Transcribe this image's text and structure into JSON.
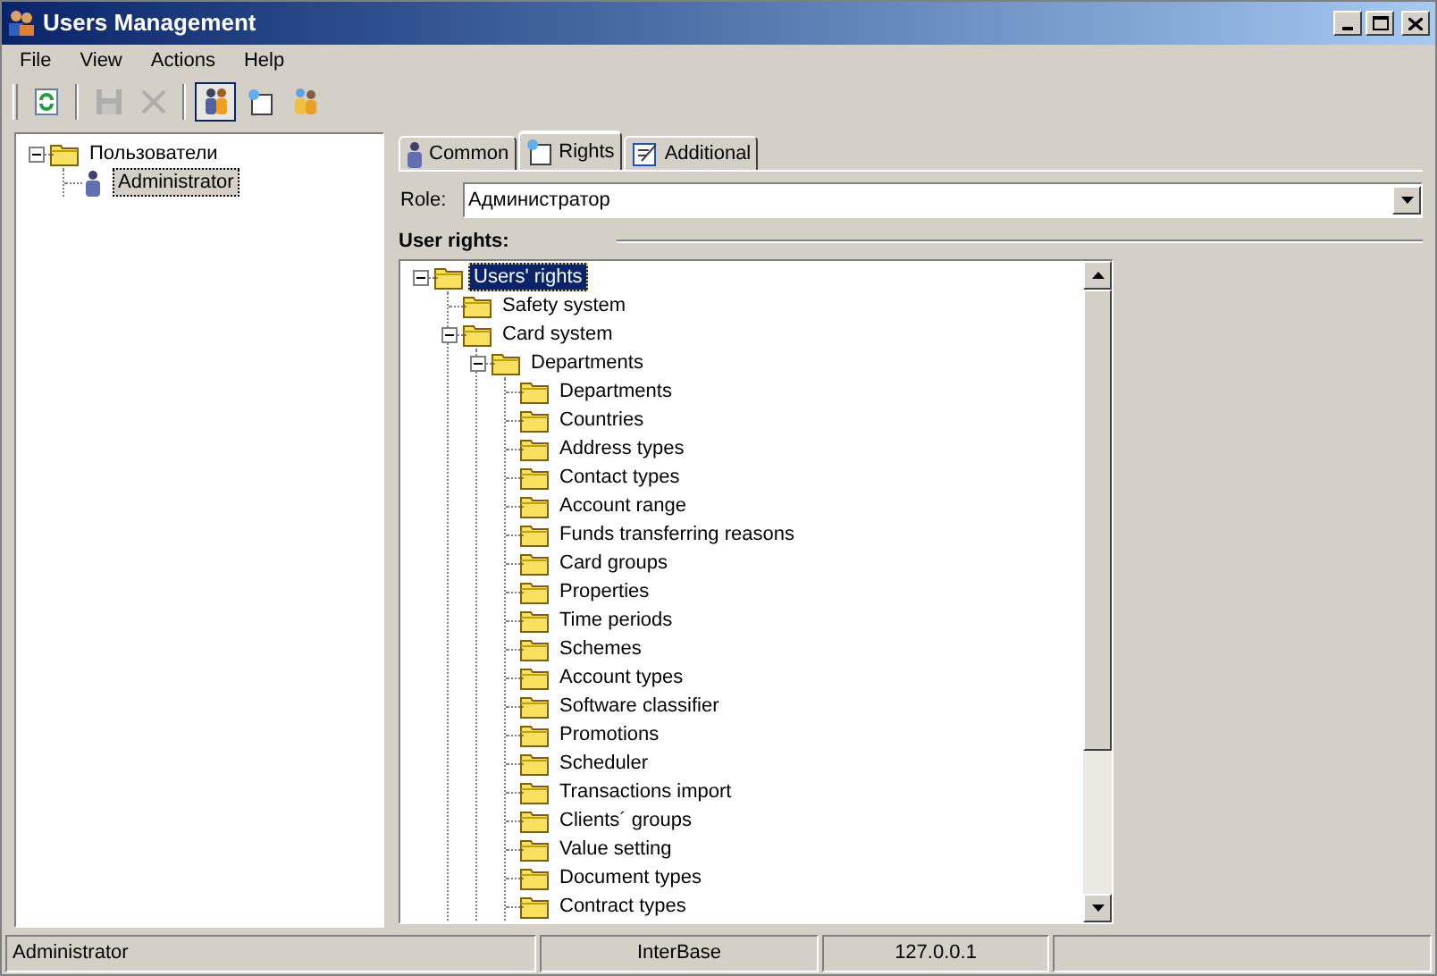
{
  "window": {
    "title": "Users Management"
  },
  "menu": [
    "File",
    "View",
    "Actions",
    "Help"
  ],
  "toolbar": [
    {
      "kind": "refresh",
      "disabled": false,
      "pressed": false
    },
    {
      "kind": "separator"
    },
    {
      "kind": "save",
      "disabled": true,
      "pressed": false
    },
    {
      "kind": "delete",
      "disabled": true,
      "pressed": false
    },
    {
      "kind": "separator"
    },
    {
      "kind": "users",
      "disabled": false,
      "pressed": true
    },
    {
      "kind": "new-role",
      "disabled": false,
      "pressed": false
    },
    {
      "kind": "user-group",
      "disabled": false,
      "pressed": false
    }
  ],
  "users_tree": [
    {
      "label": "Пользователи",
      "selected": false,
      "expanded": true,
      "children": [
        {
          "label": "Administrator",
          "selected": true
        }
      ]
    }
  ],
  "tabs": [
    {
      "label": "Common",
      "selected": false
    },
    {
      "label": "Rights",
      "selected": true
    },
    {
      "label": "Additional",
      "selected": false
    }
  ],
  "role": {
    "label": "Role:",
    "value": "Администратор"
  },
  "rights_heading": "User rights:",
  "rights_tree": [
    {
      "label": "Users' rights",
      "selected": true,
      "expanded": true,
      "children": [
        {
          "label": "Safety system",
          "selected": false
        },
        {
          "label": "Card system",
          "selected": false,
          "expanded": true,
          "children": [
            {
              "label": "Departments",
              "selected": false,
              "expanded": true,
              "children": [
                {
                  "label": "Departments",
                  "selected": false
                },
                {
                  "label": "Countries",
                  "selected": false
                },
                {
                  "label": "Address types",
                  "selected": false
                },
                {
                  "label": "Contact types",
                  "selected": false
                },
                {
                  "label": "Account range",
                  "selected": false
                },
                {
                  "label": "Funds transferring reasons",
                  "selected": false
                },
                {
                  "label": "Card groups",
                  "selected": false
                },
                {
                  "label": "Properties",
                  "selected": false
                },
                {
                  "label": "Time periods",
                  "selected": false
                },
                {
                  "label": "Schemes",
                  "selected": false
                },
                {
                  "label": "Account types",
                  "selected": false
                },
                {
                  "label": "Software classifier",
                  "selected": false
                },
                {
                  "label": "Promotions",
                  "selected": false
                },
                {
                  "label": "Scheduler",
                  "selected": false
                },
                {
                  "label": "Transactions import",
                  "selected": false
                },
                {
                  "label": "Clients´ groups",
                  "selected": false
                },
                {
                  "label": "Value setting",
                  "selected": false
                },
                {
                  "label": "Document types",
                  "selected": false
                },
                {
                  "label": "Contract types",
                  "selected": false
                }
              ]
            }
          ]
        }
      ]
    }
  ],
  "status_bar": [
    "Administrator",
    "InterBase",
    "127.0.0.1"
  ]
}
